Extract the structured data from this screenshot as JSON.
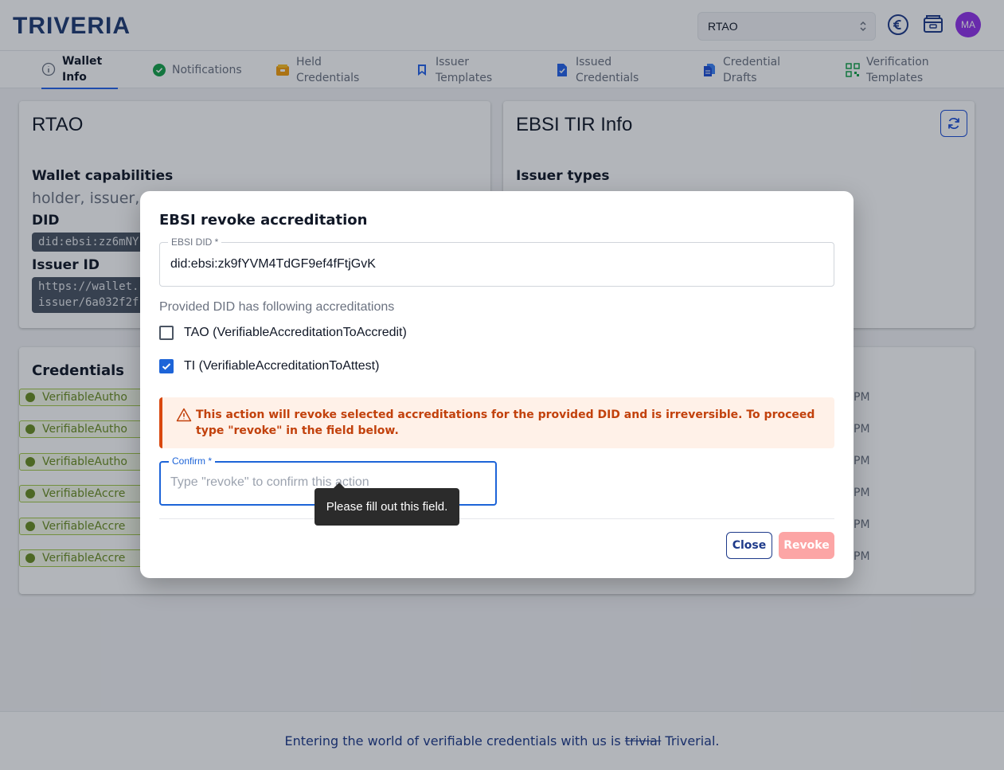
{
  "header": {
    "logo": "TRIVERIA",
    "wallet_selected": "RTAO",
    "avatar_initials": "MA"
  },
  "nav": {
    "tabs": [
      {
        "line1": "Wallet",
        "line2": "Info",
        "icon": "info-icon"
      },
      {
        "line1": "Notifications",
        "line2": "",
        "icon": "check-circle-icon"
      },
      {
        "line1": "Held",
        "line2": "Credentials",
        "icon": "wallet-icon"
      },
      {
        "line1": "Issuer",
        "line2": "Templates",
        "icon": "bookmark-icon"
      },
      {
        "line1": "Issued",
        "line2": "Credentials",
        "icon": "document-check-icon"
      },
      {
        "line1": "Credential",
        "line2": "Drafts",
        "icon": "documents-icon"
      },
      {
        "line1": "Verification",
        "line2": "Templates",
        "icon": "qr-code-icon"
      }
    ]
  },
  "wallet_card": {
    "title": "RTAO",
    "capabilities_label": "Wallet capabilities",
    "capabilities_value": "holder, issuer, v",
    "did_label": "DID",
    "did_value": "did:ebsi:zz6mNY",
    "issuer_id_label": "Issuer ID",
    "issuer_id_line1": "https://wallet.",
    "issuer_id_line2": "issuer/6a032f2f"
  },
  "ebsi_card": {
    "title": "EBSI TIR Info",
    "issuer_types_label": "Issuer types"
  },
  "credentials_card": {
    "title": "Credentials",
    "rows": [
      {
        "label": "VerifiableAutho",
        "time": "PM"
      },
      {
        "label": "VerifiableAutho",
        "time": "PM"
      },
      {
        "label": "VerifiableAutho",
        "time": "PM"
      },
      {
        "label": "VerifiableAccre",
        "time": "PM"
      },
      {
        "label": "VerifiableAccre",
        "time": "PM"
      },
      {
        "label": "VerifiableAccre",
        "time": "PM"
      }
    ]
  },
  "footer": {
    "before": "Entering the world of verifiable credentials with us is ",
    "struck": "trivial",
    "after": " Triverial."
  },
  "modal": {
    "title": "EBSI revoke accreditation",
    "did_field": {
      "label": "EBSI DID *",
      "value": "did:ebsi:zk9fYVM4TdGF9ef4fFtjGvK"
    },
    "helper": "Provided DID has following accreditations",
    "options": [
      {
        "label": "TAO (VerifiableAccreditationToAccredit)",
        "checked": false
      },
      {
        "label": "TI (VerifiableAccreditationToAttest)",
        "checked": true
      }
    ],
    "alert": "This action will revoke selected accreditations for the provided DID and is irreversible. To proceed type \"revoke\" in the field below.",
    "confirm_field": {
      "label": "Confirm *",
      "value": "",
      "placeholder": "Type \"revoke\" to confirm this action"
    },
    "tooltip": "Please fill out this field.",
    "close_label": "Close",
    "revoke_label": "Revoke"
  },
  "colors": {
    "brand": "#1f3b73",
    "accent": "#1d64d8",
    "warning": "#c2410c",
    "success": "#6b8e23",
    "danger_disabled": "#fca5a5"
  }
}
